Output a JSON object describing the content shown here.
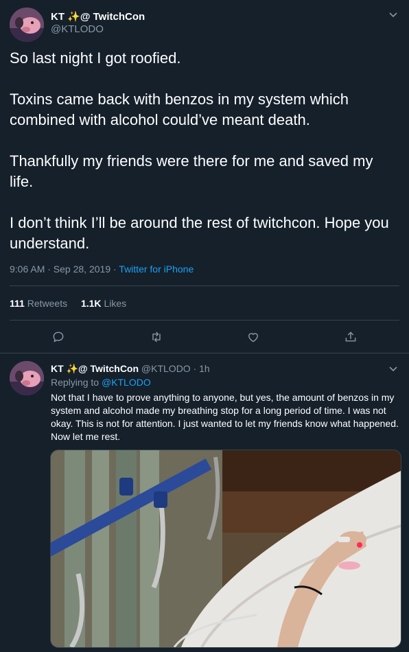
{
  "main_tweet": {
    "author_name": "KT ✨@ TwitchCon",
    "author_handle": "@KTLODO",
    "paragraphs": [
      "So last night I got roofied.",
      "Toxins came back with benzos in my system which combined with alcohol could’ve meant death.",
      "Thankfully my friends were there for me and saved my life.",
      "I don’t think I’ll be around the rest of twitchcon. Hope you understand."
    ],
    "timestamp": "9:06 AM · Sep 28, 2019 · ",
    "source": "Twitter for iPhone",
    "retweet_count": "111",
    "retweet_label": "Retweets",
    "like_count": "1.1K",
    "like_label": "Likes"
  },
  "actions": {
    "reply_icon": "reply-icon",
    "retweet_icon": "retweet-icon",
    "like_icon": "heart-icon",
    "share_icon": "share-icon"
  },
  "reply_tweet": {
    "author_name": "KT ✨@ TwitchCon",
    "author_handle": "@KTLODO",
    "time": "· 1h",
    "replying_prefix": "Replying to ",
    "replying_handle": "@KTLODO",
    "text": "Not that I have to prove anything to anyone, but yes, the amount of benzos in my system and alcohol made my breathing stop for a long period of time. I was not okay. This is not for attention. I just wanted to let my friends know what happened. Now let me rest."
  },
  "colors": {
    "background": "#15202b",
    "secondary_text": "#8899a6",
    "link": "#1da1f2",
    "divider": "#38444d"
  }
}
